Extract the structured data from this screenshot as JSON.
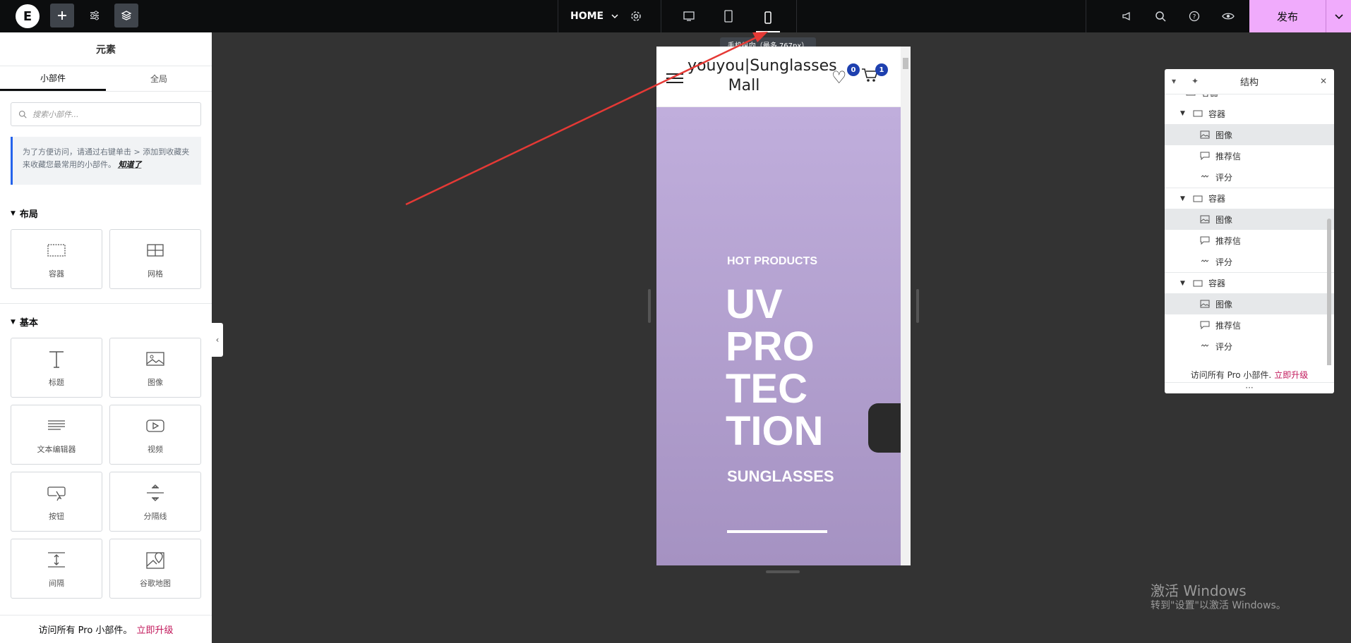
{
  "topbar": {
    "logo": "E",
    "page_name": "HOME",
    "tooltip": "手机纵向（最多 767px）",
    "publish_label": "发布"
  },
  "panel": {
    "title": "元素",
    "tabs": [
      "小部件",
      "全局"
    ],
    "search_placeholder": "搜索小部件...",
    "tip_text": "为了方便访问，请通过右键单击 > 添加到收藏夹来收藏您最常用的小部件。",
    "tip_link": "知道了",
    "sections": {
      "layout": "布局",
      "basic": "基本"
    },
    "layout_widgets": [
      "容器",
      "网格"
    ],
    "basic_widgets": [
      "标题",
      "图像",
      "文本编辑器",
      "视频",
      "按钮",
      "分隔线",
      "间隔",
      "谷歌地图"
    ],
    "footer_text": "访问所有 Pro 小部件。",
    "footer_link": "立即升级"
  },
  "preview": {
    "site_title": "youyou|Sunglasses Mall",
    "wishlist_count": "0",
    "cart_count": "1",
    "hero_sub": "HOT PRODUCTS",
    "hero_title": "UV PRO TEC TION",
    "hero_tag": "SUNGLASSES"
  },
  "structure": {
    "title": "结构",
    "partial_top": "容器",
    "groups": [
      {
        "container": "容器",
        "items": [
          "图像",
          "推荐信",
          "评分"
        ]
      },
      {
        "container": "容器",
        "items": [
          "图像",
          "推荐信",
          "评分"
        ]
      },
      {
        "container": "容器",
        "items": [
          "图像",
          "推荐信",
          "评分"
        ]
      }
    ],
    "footer_text": "访问所有 Pro 小部件.",
    "footer_link": "立即升级"
  },
  "watermark": {
    "line1": "激活 Windows",
    "line2": "转到\"设置\"以激活 Windows。"
  }
}
